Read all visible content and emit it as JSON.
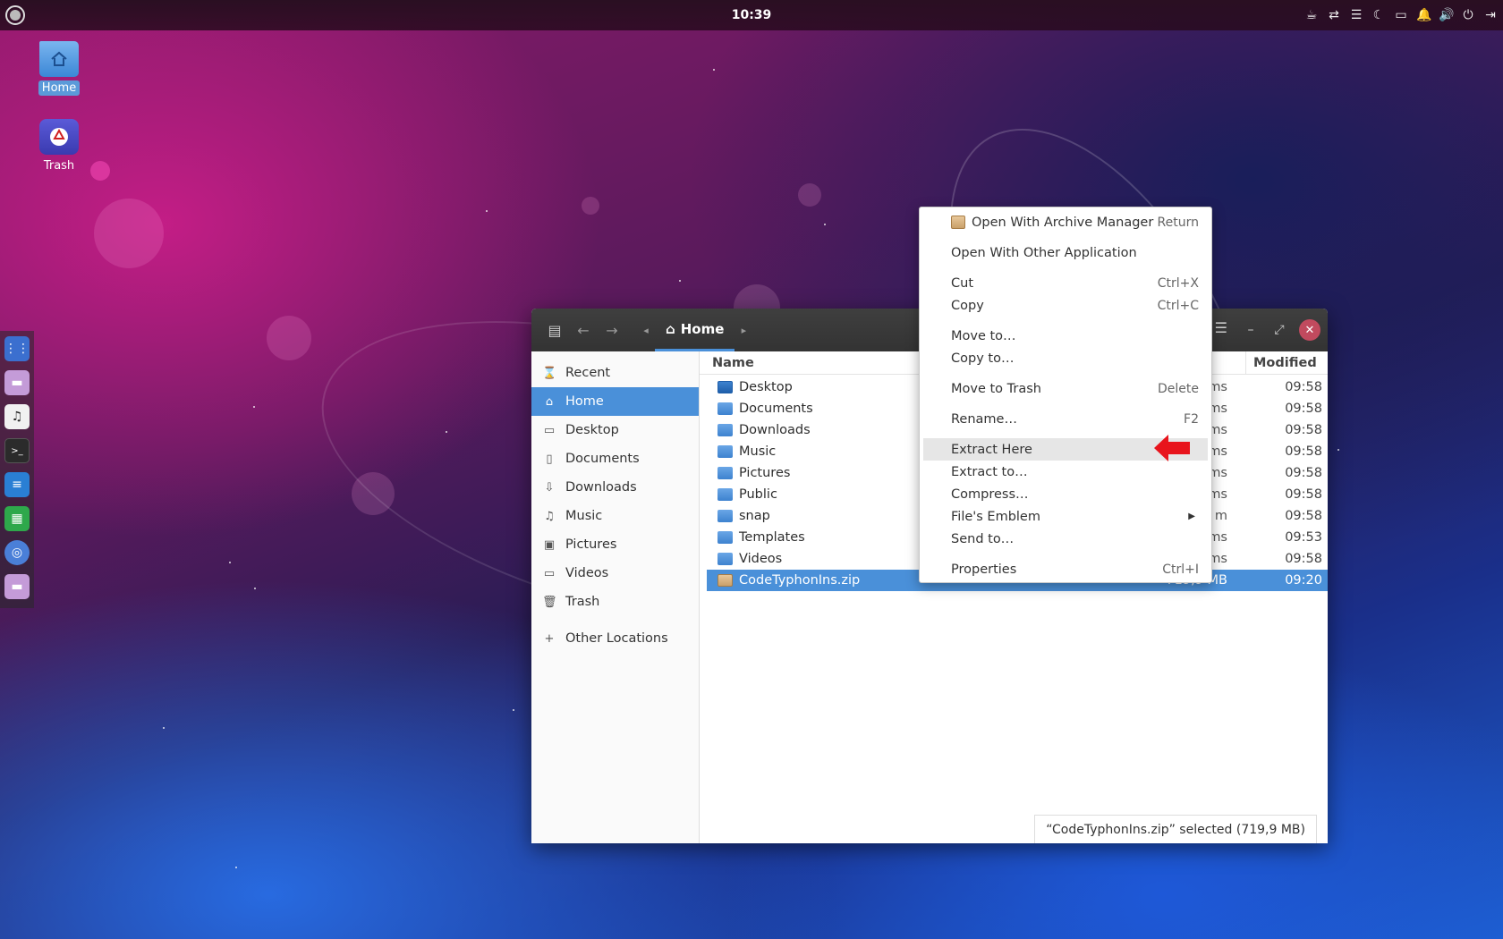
{
  "topbar": {
    "clock": "10:39"
  },
  "desktop": {
    "icons": [
      {
        "label": "Home"
      },
      {
        "label": "Trash"
      }
    ]
  },
  "window": {
    "breadcrumb": "Home",
    "sidebar": [
      {
        "label": "Recent",
        "icon": "clock-icon"
      },
      {
        "label": "Home",
        "icon": "home-icon",
        "active": true
      },
      {
        "label": "Desktop",
        "icon": "desktop-icon"
      },
      {
        "label": "Documents",
        "icon": "document-icon"
      },
      {
        "label": "Downloads",
        "icon": "download-icon"
      },
      {
        "label": "Music",
        "icon": "music-icon"
      },
      {
        "label": "Pictures",
        "icon": "picture-icon"
      },
      {
        "label": "Videos",
        "icon": "video-icon"
      },
      {
        "label": "Trash",
        "icon": "trash-icon"
      },
      {
        "label": "Other Locations",
        "icon": "plus-icon"
      }
    ],
    "columns": {
      "name": "Name",
      "modified": "Modified"
    },
    "files": [
      {
        "name": "Desktop",
        "size": "ms",
        "modified": "09:58"
      },
      {
        "name": "Documents",
        "size": "ms",
        "modified": "09:58"
      },
      {
        "name": "Downloads",
        "size": "ms",
        "modified": "09:58"
      },
      {
        "name": "Music",
        "size": "ms",
        "modified": "09:58"
      },
      {
        "name": "Pictures",
        "size": "ms",
        "modified": "09:58"
      },
      {
        "name": "Public",
        "size": "ms",
        "modified": "09:58"
      },
      {
        "name": "snap",
        "size": "m",
        "modified": "09:58"
      },
      {
        "name": "Templates",
        "size": "ms",
        "modified": "09:53"
      },
      {
        "name": "Videos",
        "size": "ms",
        "modified": "09:58"
      },
      {
        "name": "CodeTyphonIns.zip",
        "size": "719,9 MB",
        "modified": "09:20",
        "selected": true
      }
    ],
    "status": "“CodeTyphonIns.zip” selected  (719,9 MB)"
  },
  "context_menu": {
    "items": [
      {
        "label": "Open With Archive Manager",
        "shortcut": "Return"
      },
      {
        "label": "Open With Other Application",
        "shortcut": ""
      },
      {
        "label": "Cut",
        "shortcut": "Ctrl+X"
      },
      {
        "label": "Copy",
        "shortcut": "Ctrl+C"
      },
      {
        "label": "Move to…",
        "shortcut": ""
      },
      {
        "label": "Copy to…",
        "shortcut": ""
      },
      {
        "label": "Move to Trash",
        "shortcut": "Delete"
      },
      {
        "label": "Rename…",
        "shortcut": "F2"
      },
      {
        "label": "Extract Here",
        "shortcut": ""
      },
      {
        "label": "Extract to…",
        "shortcut": ""
      },
      {
        "label": "Compress…",
        "shortcut": ""
      },
      {
        "label": "File's Emblem",
        "shortcut": ""
      },
      {
        "label": "Send to…",
        "shortcut": ""
      },
      {
        "label": "Properties",
        "shortcut": "Ctrl+I"
      }
    ]
  },
  "colors": {
    "selection": "#4a90d9",
    "close_button": "#c14a5e",
    "annotation_arrow": "#e8141c"
  }
}
